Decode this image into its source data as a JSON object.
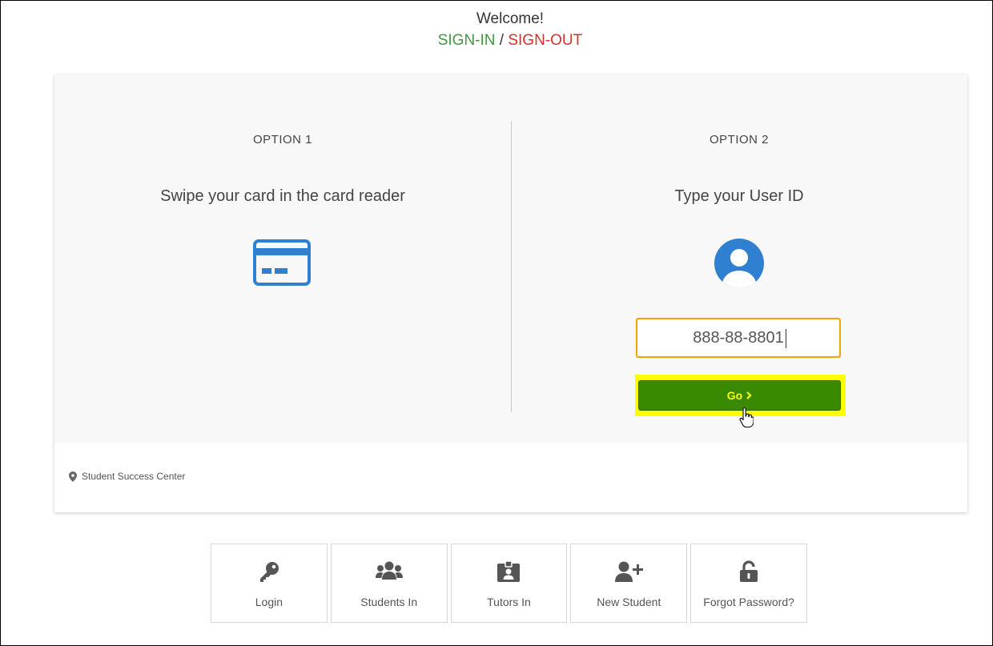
{
  "header": {
    "welcome": "Welcome!",
    "sign_in": "SIGN-IN",
    "separator": " / ",
    "sign_out": "SIGN-OUT"
  },
  "options": {
    "option1": {
      "label": "OPTION 1",
      "title": "Swipe your card in the card reader",
      "icon": "credit-card-icon"
    },
    "option2": {
      "label": "OPTION 2",
      "title": "Type your User ID",
      "icon": "user-circle-icon",
      "input_value": "888-88-8801",
      "go_label": "Go",
      "go_icon": "chevron-right-icon"
    }
  },
  "location": {
    "icon": "map-marker-icon",
    "text": "Student Success Center"
  },
  "tiles": [
    {
      "label": "Login",
      "icon": "key-icon"
    },
    {
      "label": "Students In",
      "icon": "users-icon"
    },
    {
      "label": "Tutors In",
      "icon": "id-badge-icon"
    },
    {
      "label": "New Student",
      "icon": "user-plus-icon"
    },
    {
      "label": "Forgot Password?",
      "icon": "unlock-icon"
    }
  ],
  "colors": {
    "sign_in": "#3f9a3f",
    "sign_out": "#d9302c",
    "icon_blue": "#2f80d0",
    "go_button": "#3a8a00",
    "go_text": "#ffff00",
    "highlight": "#ffff00",
    "input_border": "#f0a500",
    "tile_icon": "#555555"
  }
}
